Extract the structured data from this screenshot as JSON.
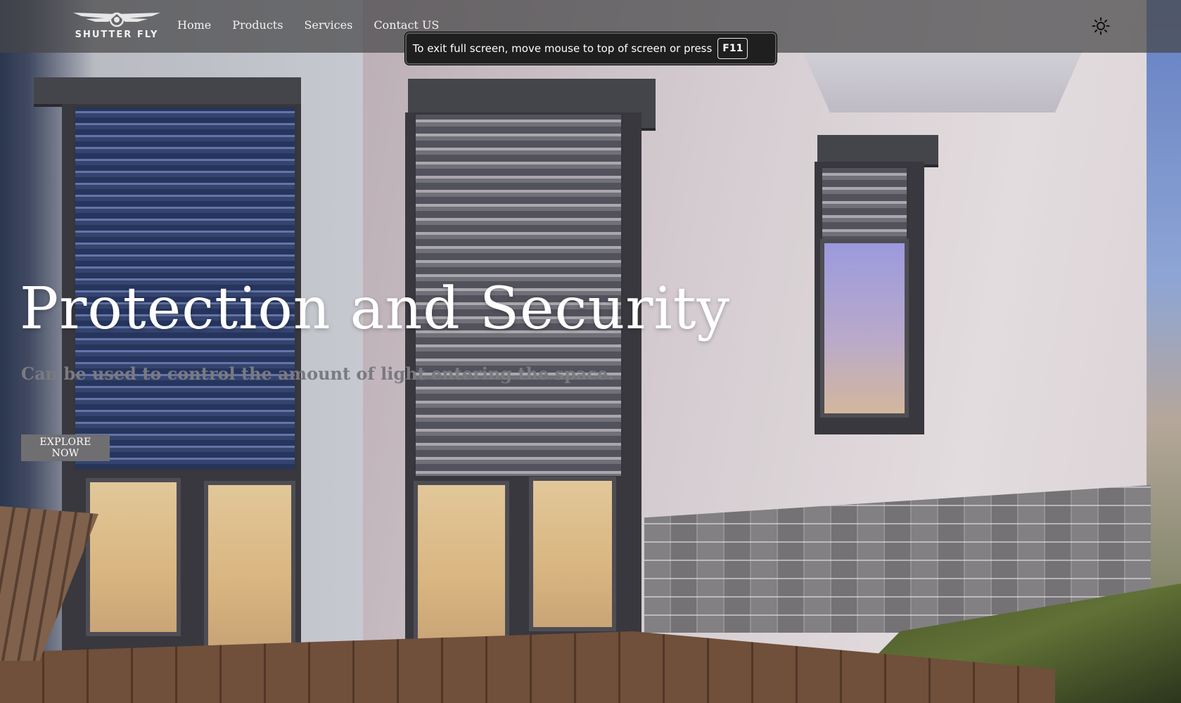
{
  "brand": {
    "name": "SHUTTER FLY",
    "logo_icon": "winged-emblem-icon"
  },
  "nav": {
    "links": [
      {
        "label": "Home"
      },
      {
        "label": "Products"
      },
      {
        "label": "Services"
      },
      {
        "label": "Contact US"
      }
    ],
    "theme_toggle_icon": "sun-icon"
  },
  "fullscreen_notice": {
    "text": "To exit full screen, move mouse to top of screen or press",
    "key": "F11"
  },
  "hero": {
    "title": "Protection and Security",
    "subtitle": "Can be used to control the amount of light entering the space.",
    "cta_label": "EXPLORE NOW"
  },
  "colors": {
    "navbar": "#464648",
    "cta_button": "#6f6f72",
    "subtitle": "#7a7a80",
    "notice_bg": "#1f1f1f"
  }
}
